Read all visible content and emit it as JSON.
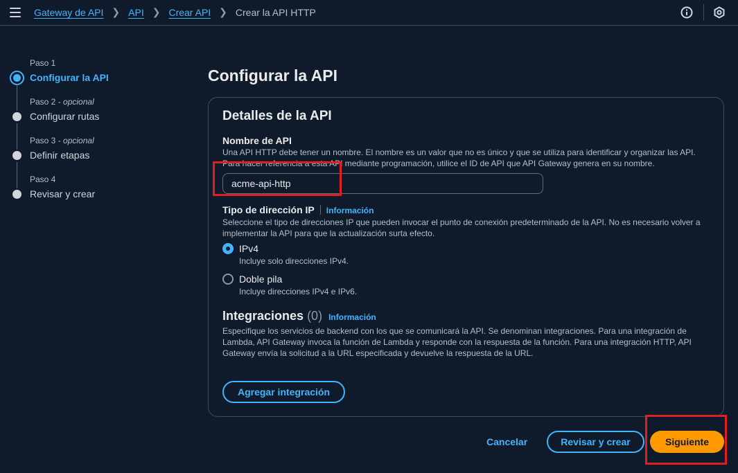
{
  "breadcrumbs": [
    {
      "label": "Gateway de API"
    },
    {
      "label": "API"
    },
    {
      "label": "Crear API"
    },
    {
      "label": "Crear la API HTTP"
    }
  ],
  "icons": {
    "menu": "hamburger-menu-icon",
    "info": "info-circle-icon",
    "settings": "hexagon-settings-icon",
    "separator": "chevron-right-icon"
  },
  "steps": [
    {
      "label": "Paso 1",
      "optional": "",
      "title": "Configurar la API",
      "active": true
    },
    {
      "label": "Paso 2 - ",
      "optional": "opcional",
      "title": "Configurar rutas",
      "active": false
    },
    {
      "label": "Paso 3 - ",
      "optional": "opcional",
      "title": "Definir etapas",
      "active": false
    },
    {
      "label": "Paso 4",
      "optional": "",
      "title": "Revisar y crear",
      "active": false
    }
  ],
  "page_title": "Configurar la API",
  "panel": {
    "title": "Detalles de la API",
    "api_name": {
      "label": "Nombre de API",
      "description": "Una API HTTP debe tener un nombre. El nombre es un valor que no es único y que se utiliza para identificar y organizar las API. Para hacer referencia a esta API mediante programación, utilice el ID de API que API Gateway genera en su nombre.",
      "value": "acme-api-http"
    },
    "ip_type": {
      "label": "Tipo de dirección IP",
      "info": "Información",
      "description": "Seleccione el tipo de direcciones IP que pueden invocar el punto de conexión predeterminado de la API. No es necesario volver a implementar la API para que la actualización surta efecto.",
      "options": [
        {
          "label": "IPv4",
          "hint": "Incluye solo direcciones IPv4.",
          "checked": true
        },
        {
          "label": "Doble pila",
          "hint": "Incluye direcciones IPv4 e IPv6.",
          "checked": false
        }
      ]
    },
    "integrations": {
      "title": "Integraciones",
      "count": "(0)",
      "info": "Información",
      "description": "Especifique los servicios de backend con los que se comunicará la API. Se denominan integraciones. Para una integración de Lambda, API Gateway invoca la función de Lambda y responde con la respuesta de la función. Para una integración HTTP, API Gateway envía la solicitud a la URL especificada y devuelve la respuesta de la URL.",
      "add_button": "Agregar integración"
    }
  },
  "footer": {
    "cancel": "Cancelar",
    "review": "Revisar y crear",
    "next": "Siguiente"
  },
  "colors": {
    "background": "#0f1b2a",
    "link": "#42b4ff",
    "primary": "#ff9900",
    "highlight": "#e0201f"
  }
}
